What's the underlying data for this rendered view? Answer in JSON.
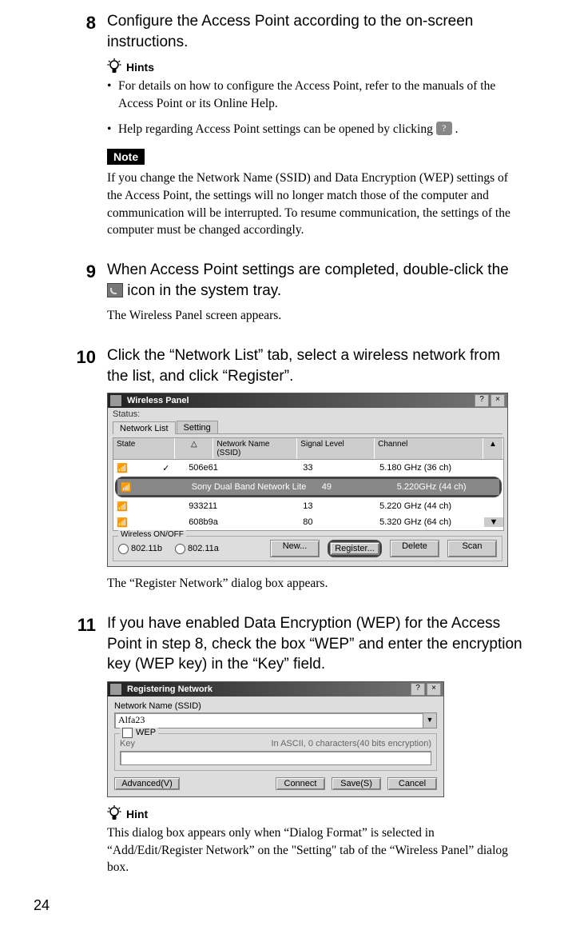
{
  "page_number": "24",
  "step8": {
    "number": "8",
    "title": "Configure the Access Point according to the on-screen instructions.",
    "hints_label": "Hints",
    "hint1": "For details on how to configure the Access Point, refer to the manuals of the Access Point or its Online Help.",
    "hint2": "Help regarding Access Point settings can be opened by clicking ",
    "hint2_suffix": " .",
    "note_label": "Note",
    "note_text": "If you change the Network Name (SSID) and Data Encryption (WEP) settings of the Access Point, the settings will no longer match those of the computer and communication will be interrupted. To resume communication, the settings of the computer must be changed accordingly."
  },
  "step9": {
    "number": "9",
    "title_a": "When Access Point settings are completed, double-click the ",
    "title_b": " icon in the system tray.",
    "result": "The Wireless Panel screen appears."
  },
  "step10": {
    "number": "10",
    "title": "Click the “Network List” tab, select a wireless network from the list, and click “Register”.",
    "result": "The “Register Network” dialog box appears.",
    "window": {
      "title": "Wireless Panel",
      "help_btn": "?",
      "close_btn": "×",
      "status_label": "Status:",
      "tabs": {
        "t1": "Network List",
        "t2": "Setting"
      },
      "headers": {
        "state": "State",
        "chk": "△",
        "name": "Network Name (SSID)",
        "signal": "Signal Level",
        "channel": "Channel",
        "scroll_up": "▲",
        "scroll_down": "▼"
      },
      "rows": [
        {
          "name": "506e61",
          "chk": "✓",
          "signal": "33",
          "channel": "5.180 GHz (36 ch)"
        },
        {
          "name": "Sony Dual Band Network Lite",
          "chk": "",
          "signal": "49",
          "channel": "5.220GHz (44 ch)"
        },
        {
          "name": "933211",
          "chk": "",
          "signal": "13",
          "channel": "5.220 GHz (44 ch)"
        },
        {
          "name": "608b9a",
          "chk": "",
          "signal": "80",
          "channel": "5.320 GHz (64 ch)"
        }
      ],
      "wireless_label": "Wireless ON/OFF",
      "r1": "802.11b",
      "r2": "802.11a",
      "btn_new": "New...",
      "btn_register": "Register...",
      "btn_delete": "Delete",
      "btn_scan": "Scan"
    }
  },
  "step11": {
    "number": "11",
    "title": "If you have enabled Data Encryption (WEP) for the Access Point in step 8, check the box “WEP” and enter the encryption key (WEP key) in the “Key” field.",
    "window": {
      "title": "Registering Network",
      "help_btn": "?",
      "close_btn": "×",
      "ssid_label": "Network Name (SSID)",
      "ssid_value": "Alfa23",
      "wep_label": "WEP",
      "key_label": "Key",
      "key_desc": "In ASCII, 0 characters(40 bits encryption)",
      "btn_adv": "Advanced(V)",
      "btn_connect": "Connect",
      "btn_save": "Save(S)",
      "btn_cancel": "Cancel"
    },
    "hint_label": "Hint",
    "hint_text": "This dialog box appears only when “Dialog Format” is selected in “Add/Edit/Register Network” on the \"Setting\" tab of the “Wireless Panel” dialog box."
  }
}
